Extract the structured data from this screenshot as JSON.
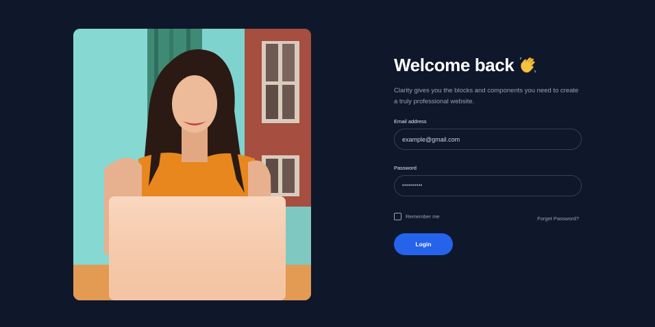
{
  "login": {
    "title": "Welcome back",
    "wave_icon": "waving-hand-icon",
    "subtitle": "Clarity gives you the blocks and components you need to create a truly professional website.",
    "email_label": "Email address",
    "email_placeholder": "example@gmail.com",
    "password_label": "Password",
    "password_value": "••••••••••",
    "remember_label": "Remember me",
    "forgot_label": "Forget Password?",
    "login_label": "Login"
  },
  "colors": {
    "background": "#0f172b",
    "accent": "#2563eb",
    "muted_text": "#94a3b8",
    "input_border": "#334155"
  }
}
